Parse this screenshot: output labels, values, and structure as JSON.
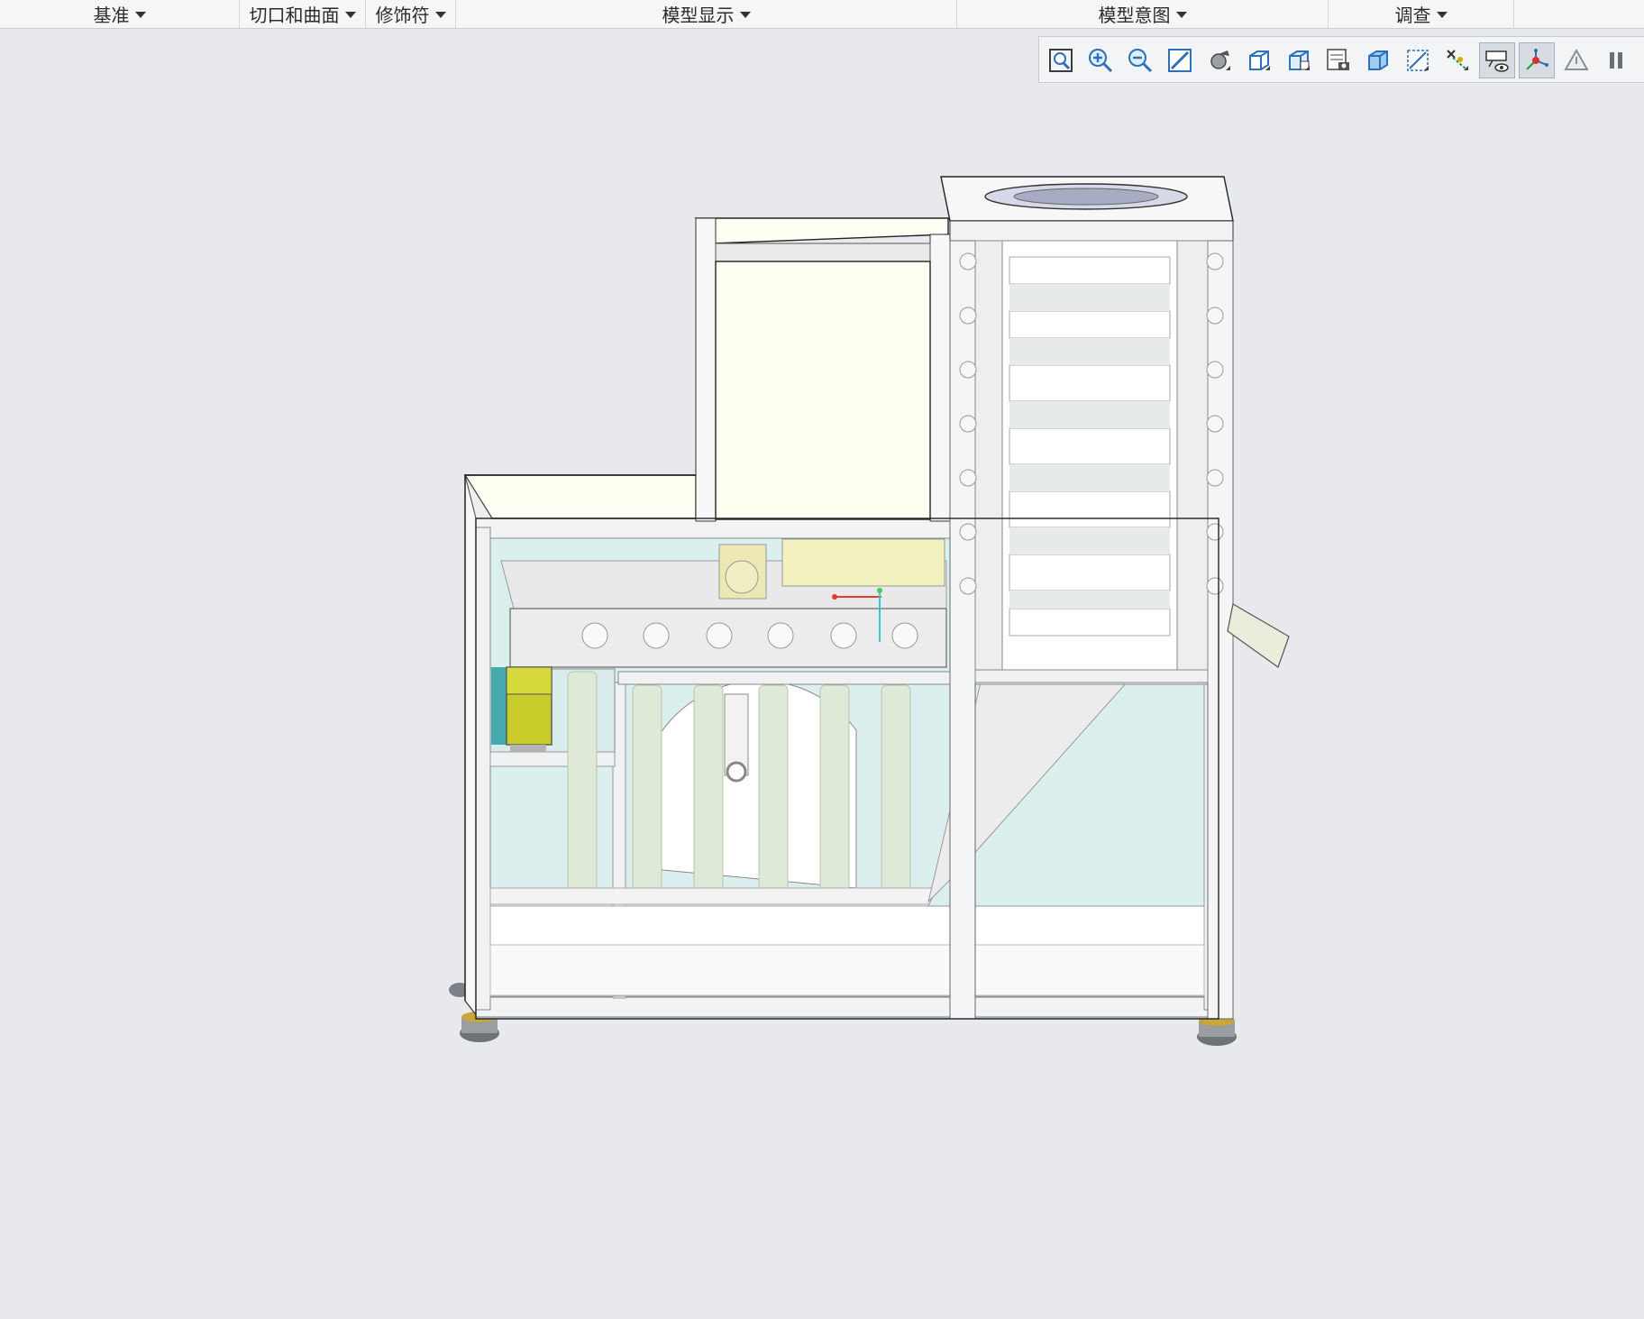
{
  "ribbon": {
    "groups": [
      {
        "label": "基准"
      },
      {
        "label": "切口和曲面"
      },
      {
        "label": "修饰符"
      },
      {
        "label": "模型显示"
      },
      {
        "label": "模型意图"
      },
      {
        "label": "调查"
      }
    ]
  },
  "view_toolbar": {
    "buttons": [
      {
        "icon": "refit-icon",
        "active": false
      },
      {
        "icon": "zoom-in-icon",
        "active": false
      },
      {
        "icon": "zoom-out-icon",
        "active": false
      },
      {
        "icon": "repaint-icon",
        "active": false
      },
      {
        "icon": "perspective-view-icon",
        "active": false
      },
      {
        "icon": "display-style-icon",
        "active": false
      },
      {
        "icon": "saved-orientations-icon",
        "active": false
      },
      {
        "icon": "view-manager-icon",
        "active": false
      },
      {
        "icon": "section-view-icon",
        "active": false
      },
      {
        "icon": "datum-planes-icon",
        "active": false
      },
      {
        "icon": "datum-points-icon",
        "active": false
      },
      {
        "icon": "annotation-display-icon",
        "active": true
      },
      {
        "icon": "spin-center-icon",
        "active": true
      },
      {
        "icon": "simulation-icon",
        "active": false
      },
      {
        "icon": "pause-icon",
        "active": false
      }
    ]
  },
  "viewport": {
    "model": "机架装配体"
  },
  "colors": {
    "glass": "#dcefef",
    "frame": "#f4f5f6",
    "motor_yellow": "#c9cc2a",
    "beige_panel": "#fffff3",
    "teal": "#45a9ad",
    "accent_x": "#e53935",
    "accent_y": "#3fd15a",
    "accent_z": "#33c7d6"
  }
}
